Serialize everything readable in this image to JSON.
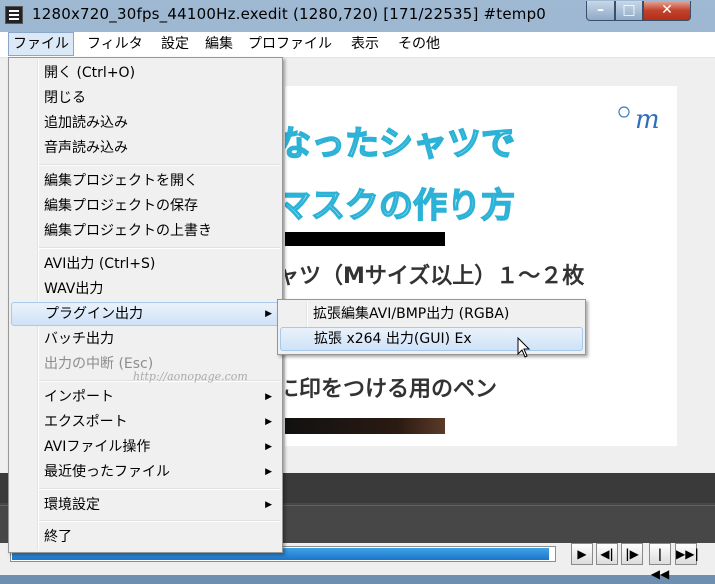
{
  "window": {
    "title": "1280x720_30fps_44100Hz.exedit (1280,720)  [171/22535]  #temp0",
    "buttons": {
      "minimize": "–",
      "maximize": "□",
      "close": "✕"
    }
  },
  "menubar": [
    {
      "label": "ファイル",
      "active": true
    },
    {
      "label": "フィルタ"
    },
    {
      "label": "設定"
    },
    {
      "label": "編集"
    },
    {
      "label": "プロファイル"
    },
    {
      "label": "表示"
    },
    {
      "label": "その他"
    }
  ],
  "video_preview": {
    "line1": "なったシャツで",
    "line2": "マスクの作り方",
    "line3": "ャツ（Mサイズ以上）１～２枚",
    "line4": "",
    "line5": "...",
    "line6": "に印をつける用のペン",
    "logo_text": "m"
  },
  "file_menu": {
    "items": [
      {
        "label": "開く (Ctrl+O)"
      },
      {
        "label": "閉じる"
      },
      {
        "label": "追加読み込み"
      },
      {
        "label": "音声読み込み"
      },
      {
        "separator": true
      },
      {
        "label": "編集プロジェクトを開く"
      },
      {
        "label": "編集プロジェクトの保存"
      },
      {
        "label": "編集プロジェクトの上書き"
      },
      {
        "separator": true
      },
      {
        "label": "AVI出力 (Ctrl+S)"
      },
      {
        "label": "WAV出力"
      },
      {
        "label": "プラグイン出力",
        "submenu": true,
        "highlighted": true
      },
      {
        "label": "バッチ出力"
      },
      {
        "label": "出力の中断 (Esc)",
        "disabled": true
      },
      {
        "separator": true
      },
      {
        "label": "インポート",
        "submenu": true
      },
      {
        "label": "エクスポート",
        "submenu": true
      },
      {
        "label": "AVIファイル操作",
        "submenu": true
      },
      {
        "label": "最近使ったファイル",
        "submenu": true
      },
      {
        "separator": true
      },
      {
        "label": "環境設定",
        "submenu": true
      },
      {
        "separator": true
      },
      {
        "label": "終了"
      }
    ],
    "watermark": "http://aonopage.com"
  },
  "plugin_submenu": {
    "items": [
      {
        "label": "拡張編集AVI/BMP出力 (RGBA)"
      },
      {
        "label": "拡張 x264 出力(GUI) Ex",
        "highlighted": true
      }
    ]
  },
  "playback": {
    "seek_progress": 0.99,
    "buttons": [
      "▶",
      "◀|",
      "|▶",
      "|◀◀",
      "▶▶|"
    ],
    "frame_label": "1"
  },
  "colors": {
    "accent": "#1d75c8",
    "title_text_stroke": "#2bb2d6",
    "close_button": "#c2422c"
  }
}
